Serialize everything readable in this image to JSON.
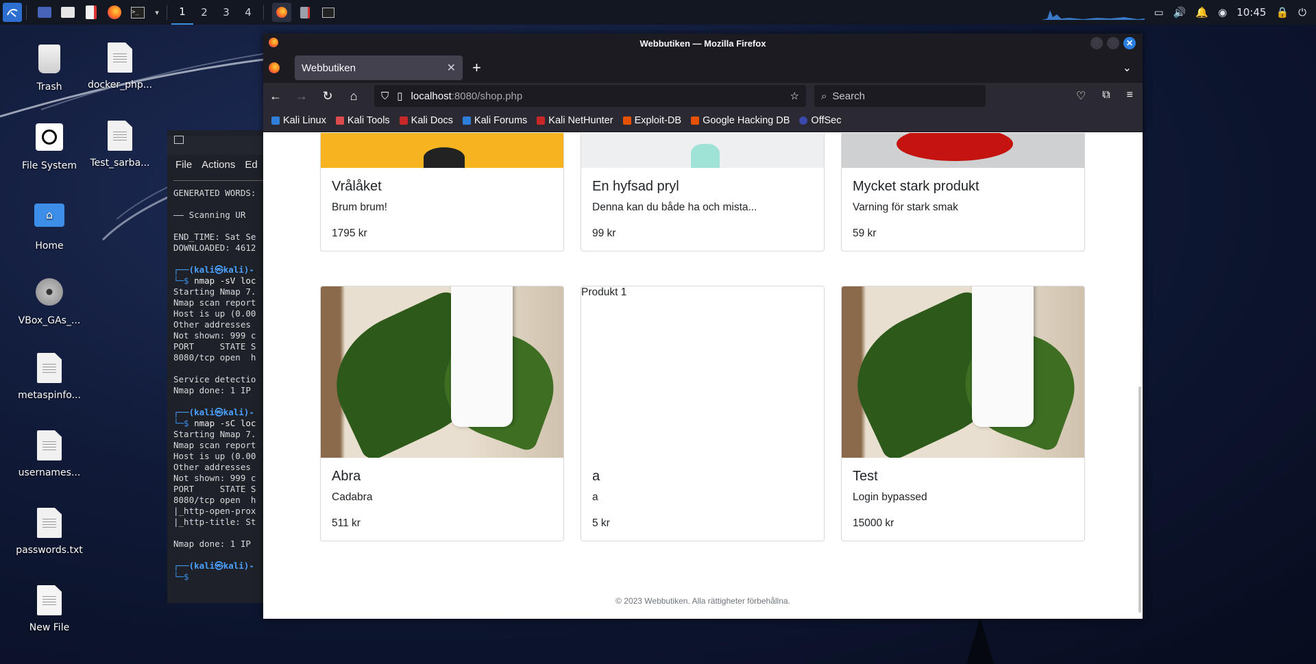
{
  "taskbar": {
    "workspaces": [
      "1",
      "2",
      "3",
      "4"
    ],
    "clock": "10:45"
  },
  "desktop": {
    "icons": [
      {
        "label": "Trash"
      },
      {
        "label": "docker_php..."
      },
      {
        "label": "File System"
      },
      {
        "label": "Test_sarba..."
      },
      {
        "label": "Home"
      },
      {
        "label": "VBox_GAs_..."
      },
      {
        "label": "metaspinfo..."
      },
      {
        "label": "usernames..."
      },
      {
        "label": "passwords.txt"
      },
      {
        "label": "New File"
      }
    ]
  },
  "terminal": {
    "menu": [
      "File",
      "Actions",
      "Ed"
    ],
    "lines": [
      "GENERATED WORDS:",
      "",
      "—— Scanning UR",
      "",
      "END_TIME: Sat Se",
      "DOWNLOADED: 4612",
      "",
      "(kali㉿kali)-",
      "$ nmap -sV loc",
      "Starting Nmap 7.",
      "Nmap scan report",
      "Host is up (0.00",
      "Other addresses",
      "Not shown: 999 c",
      "PORT     STATE S",
      "8080/tcp open  h",
      "",
      "Service detectio",
      "Nmap done: 1 IP",
      "",
      "(kali㉿kali)-",
      "$ nmap -sC loc",
      "Starting Nmap 7.",
      "Nmap scan report",
      "Host is up (0.00",
      "Other addresses",
      "Not shown: 999 c",
      "PORT     STATE S",
      "8080/tcp open  h",
      "|_http-open-prox",
      "|_http-title: St",
      "",
      "Nmap done: 1 IP",
      "",
      "(kali㉿kali)-",
      "$ "
    ]
  },
  "firefox": {
    "window_title": "Webbutiken — Mozilla Firefox",
    "tab_title": "Webbutiken",
    "url_host": "localhost",
    "url_path": ":8080/shop.php",
    "search_placeholder": "Search",
    "bookmarks": [
      {
        "label": "Kali Linux",
        "color": "#2f7ed8"
      },
      {
        "label": "Kali Tools",
        "color": "#d94b4b"
      },
      {
        "label": "Kali Docs",
        "color": "#c62828"
      },
      {
        "label": "Kali Forums",
        "color": "#2f7ed8"
      },
      {
        "label": "Kali NetHunter",
        "color": "#c62828"
      },
      {
        "label": "Exploit-DB",
        "color": "#e65100"
      },
      {
        "label": "Google Hacking DB",
        "color": "#e65100"
      },
      {
        "label": "OffSec",
        "color": "#3949ab"
      }
    ]
  },
  "shop": {
    "products_top": [
      {
        "title": "Vrålåket",
        "text": "Brum brum!",
        "price": "1795 kr",
        "image": "yellow-product-photo"
      },
      {
        "title": "En hyfsad pryl",
        "text": "Denna kan du både ha och mista...",
        "price": "99 kr",
        "image": "mint-bottle-photo"
      },
      {
        "title": "Mycket stark produkt",
        "text": "Varning för stark smak",
        "price": "59 kr",
        "image": "red-chili-photo"
      }
    ],
    "products_bottom": [
      {
        "title": "Abra",
        "text": "Cadabra",
        "price": "511 kr",
        "image": "cream-tube-leaves-photo"
      },
      {
        "title": "a",
        "text": "a",
        "price": "5 kr",
        "image_alt": "Produkt 1"
      },
      {
        "title": "Test",
        "text": "Login bypassed",
        "price": "15000 kr",
        "image": "cream-tube-leaves-photo"
      }
    ],
    "footer": "© 2023 Webbutiken. Alla rättigheter förbehållna."
  }
}
